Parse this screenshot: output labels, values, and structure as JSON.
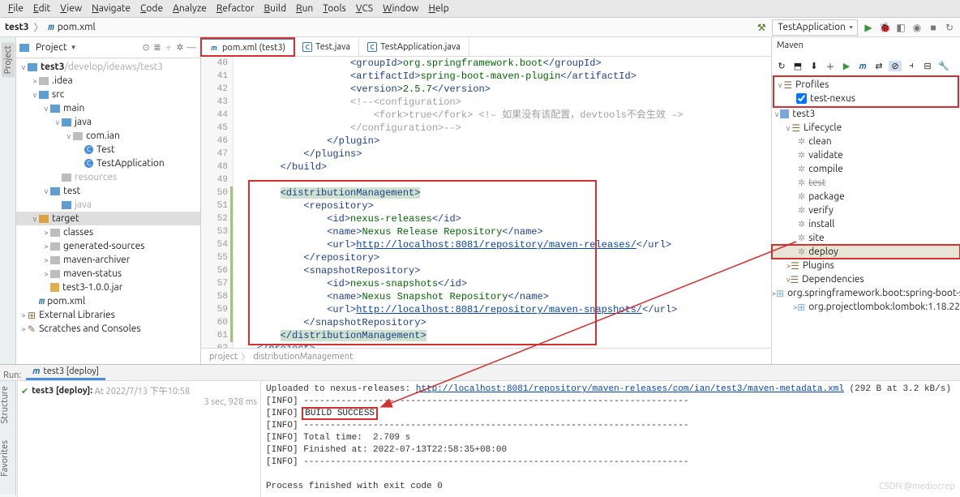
{
  "menu": {
    "items": [
      "File",
      "Edit",
      "View",
      "Navigate",
      "Code",
      "Analyze",
      "Refactor",
      "Build",
      "Run",
      "Tools",
      "VCS",
      "Window",
      "Help"
    ]
  },
  "breadcrumb": {
    "project": "test3",
    "file": "pom.xml"
  },
  "runcfg": "TestApplication",
  "project_panel": {
    "title": "Project",
    "root": {
      "name": "test3",
      "path": "/develop/ideaws/test3"
    },
    "nodes": [
      {
        "indent": 1,
        "tw": ">",
        "icon": "gre",
        "label": ".idea"
      },
      {
        "indent": 1,
        "tw": "v",
        "icon": "blu",
        "label": "src"
      },
      {
        "indent": 2,
        "tw": "v",
        "icon": "blu",
        "label": "main"
      },
      {
        "indent": 3,
        "tw": "v",
        "icon": "blu",
        "label": "java"
      },
      {
        "indent": 4,
        "tw": "v",
        "icon": "gre",
        "label": "com.ian"
      },
      {
        "indent": 5,
        "tw": "",
        "icon": "cls",
        "label": "Test"
      },
      {
        "indent": 5,
        "tw": "",
        "icon": "cls",
        "label": "TestApplication"
      },
      {
        "indent": 3,
        "tw": "",
        "icon": "gre",
        "label": "resources",
        "dim": true
      },
      {
        "indent": 2,
        "tw": "v",
        "icon": "blu",
        "label": "test"
      },
      {
        "indent": 3,
        "tw": "",
        "icon": "blu",
        "label": "java",
        "dim": true
      },
      {
        "indent": 1,
        "tw": "v",
        "icon": "ora",
        "label": "target",
        "sel": true
      },
      {
        "indent": 2,
        "tw": ">",
        "icon": "gre",
        "label": "classes"
      },
      {
        "indent": 2,
        "tw": ">",
        "icon": "gre",
        "label": "generated-sources"
      },
      {
        "indent": 2,
        "tw": ">",
        "icon": "gre",
        "label": "maven-archiver"
      },
      {
        "indent": 2,
        "tw": ">",
        "icon": "gre",
        "label": "maven-status"
      },
      {
        "indent": 2,
        "tw": "",
        "icon": "jar",
        "label": "test3-1.0.0.jar"
      },
      {
        "indent": 1,
        "tw": "",
        "icon": "m",
        "label": "pom.xml"
      },
      {
        "indent": 0,
        "tw": ">",
        "icon": "lib",
        "label": "External Libraries"
      },
      {
        "indent": 0,
        "tw": ">",
        "icon": "scr",
        "label": "Scratches and Consoles"
      }
    ]
  },
  "editor": {
    "tabs": [
      {
        "label": "pom.xml (test3)",
        "icon": "m",
        "active": true,
        "red": true
      },
      {
        "label": "Test.java",
        "icon": "j"
      },
      {
        "label": "TestApplication.java",
        "icon": "j"
      }
    ],
    "lines": [
      {
        "n": 40,
        "t": "                    <groupId>org.springframework.boot</groupId>"
      },
      {
        "n": 41,
        "t": "                    <artifactId>spring-boot-maven-plugin</artifactId>"
      },
      {
        "n": 42,
        "t": "                    <version>2.5.7</version>"
      },
      {
        "n": 43,
        "t": "                    <!--<configuration>",
        "cmt": true
      },
      {
        "n": 44,
        "t": "                        <fork>true</fork> &lt;!&ndash; 如果没有该配置，devtools不会生效 &ndash;&gt;",
        "cmt": true
      },
      {
        "n": 45,
        "t": "                    </configuration>-->",
        "cmt": true
      },
      {
        "n": 46,
        "t": "                </plugin>"
      },
      {
        "n": 47,
        "t": "            </plugins>"
      },
      {
        "n": 48,
        "t": "        </build>"
      },
      {
        "n": 49,
        "t": ""
      },
      {
        "n": 50,
        "t": "        <distributionManagement>",
        "hl": true,
        "diff": true
      },
      {
        "n": 51,
        "t": "            <repository>",
        "diff": true
      },
      {
        "n": 52,
        "t": "                <id>nexus-releases</id>",
        "diff": true
      },
      {
        "n": 53,
        "t": "                <name>Nexus Release Repository</name>",
        "diff": true
      },
      {
        "n": 54,
        "t": "                <url>http://localhost:8081/repository/maven-releases/</url>",
        "url": true,
        "diff": true
      },
      {
        "n": 55,
        "t": "            </repository>",
        "diff": true
      },
      {
        "n": 56,
        "t": "            <snapshotRepository>",
        "diff": true
      },
      {
        "n": 57,
        "t": "                <id>nexus-snapshots</id>",
        "diff": true
      },
      {
        "n": 58,
        "t": "                <name>Nexus Snapshot Repository</name>",
        "diff": true
      },
      {
        "n": 59,
        "t": "                <url>http://localhost:8081/repository/maven-snapshots/</url>",
        "url": true,
        "diff": true
      },
      {
        "n": 60,
        "t": "            </snapshotRepository>",
        "diff": true
      },
      {
        "n": 61,
        "t": "        </distributionManagement>",
        "hl": true,
        "diff": true
      },
      {
        "n": 62,
        "t": "    </project>"
      }
    ],
    "crumb": [
      "project",
      "distributionManagement"
    ]
  },
  "maven": {
    "title": "Maven",
    "profiles_label": "Profiles",
    "profile": "test-nexus",
    "root": "test3",
    "lifecycle_label": "Lifecycle",
    "goals": [
      "clean",
      "validate",
      "compile",
      "test",
      "package",
      "verify",
      "install",
      "site",
      "deploy"
    ],
    "plugins_label": "Plugins",
    "deps_label": "Dependencies",
    "deps": [
      "org.springframework.boot:spring-boot-sta",
      "org.projectlombok:lombok:1.18.22"
    ]
  },
  "run": {
    "title": "Run:",
    "tab": "test3 [deploy]",
    "tree_label": "test3 [deploy]:",
    "tree_info": "At 2022/7/13 下午10:58",
    "duration": "3 sec, 928 ms",
    "console": [
      {
        "pre": "Uploaded to nexus-releases: ",
        "link": "http://localhost:8081/repository/maven-releases/com/ian/test3/maven-metadata.xml",
        "post": " (292 B at 3.2 kB/s)"
      },
      {
        "txt": "[INFO] ------------------------------------------------------------------------"
      },
      {
        "txt": "[INFO] ",
        "build": "BUILD SUCCESS"
      },
      {
        "txt": "[INFO] ------------------------------------------------------------------------"
      },
      {
        "txt": "[INFO] Total time:  2.709 s"
      },
      {
        "txt": "[INFO] Finished at: 2022-07-13T22:58:35+08:00"
      },
      {
        "txt": "[INFO] ------------------------------------------------------------------------"
      },
      {
        "txt": ""
      },
      {
        "txt": "Process finished with exit code 0",
        "proc": true
      }
    ]
  },
  "watermark": "CSDN @mediocrep"
}
